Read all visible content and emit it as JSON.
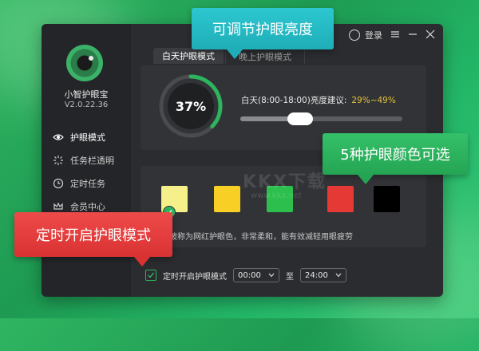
{
  "app": {
    "name": "小智护眼宝",
    "version": "V2.0.22.36"
  },
  "topbar": {
    "login_label": "登录"
  },
  "sidebar": {
    "items": [
      {
        "label": "护眼模式",
        "icon": "eye-icon",
        "active": true
      },
      {
        "label": "任务栏透明",
        "icon": "sparkle-icon",
        "active": false
      },
      {
        "label": "定时任务",
        "icon": "clock-icon",
        "active": false
      },
      {
        "label": "会员中心",
        "icon": "crown-icon",
        "active": false
      }
    ]
  },
  "tabs": [
    {
      "label": "白天护眼模式",
      "active": true
    },
    {
      "label": "晚上护眼模式",
      "active": false
    }
  ],
  "brightness": {
    "gauge_value": "37%",
    "gauge_fraction": 0.37,
    "label": "白天(8:00-18:00)亮度建议:",
    "range_text": "29%~49%",
    "slider_fraction": 0.37
  },
  "colors": {
    "swatches": [
      "#f6f08a",
      "#f7cf25",
      "#2dbf4e",
      "#e53935",
      "#000000"
    ],
    "selected_index": 0,
    "description": "色：被称为网红护眼色，非常柔和，能有效减轻用眼疲劳"
  },
  "schedule": {
    "checked": true,
    "label": "定时开启护眼模式",
    "start_time": "00:00",
    "separator": "至",
    "end_time": "24:00"
  },
  "callouts": {
    "top": "可调节护眼亮度",
    "right": "5种护眼颜色可选",
    "left": "定时开启护眼模式"
  },
  "watermark": {
    "main": "KKX下载",
    "sub": "www.kkx.net"
  },
  "theme": {
    "accent": "#2cb55d",
    "range_color": "#e2c13c"
  }
}
